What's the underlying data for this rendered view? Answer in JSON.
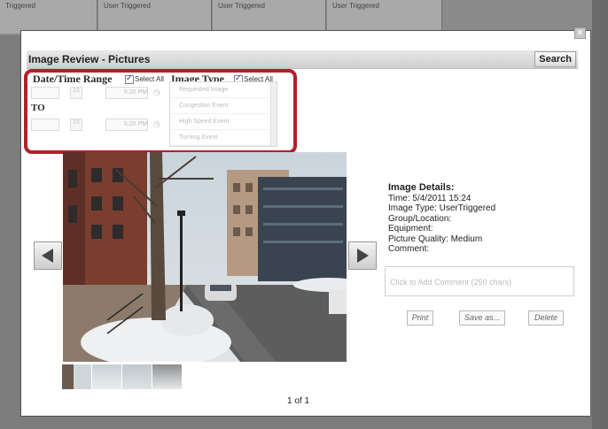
{
  "background_cells": [
    "Triggered",
    "User Triggered",
    "User Triggered",
    "User Triggered"
  ],
  "dialog": {
    "title": "Image Review - Pictures",
    "search_label": "Search",
    "close_glyph": "×"
  },
  "filters": {
    "date_range_label": "Date/Time Range",
    "select_all_label": "Select All",
    "from_time": "5:20 PM",
    "from_day": "15",
    "to_label": "TO",
    "to_time": "5:20 PM",
    "to_day": "15",
    "image_type_label": "Image Type",
    "image_types": [
      "Requested Image",
      "Congestion Event",
      "High Speed Event",
      "Turning Event"
    ]
  },
  "details": {
    "heading": "Image Details:",
    "time": "Time: 5/4/2011 15:24",
    "image_type": "Image Type: UserTriggered",
    "group": "Group/Location:",
    "equipment": "Equipment:",
    "quality": "Picture Quality: Medium",
    "comment_label": "Comment:",
    "comment_placeholder": "Click to Add Comment (250 chars)"
  },
  "actions": {
    "print": "Print",
    "save": "Save as...",
    "delete": "Delete"
  },
  "pager": "1 of 1",
  "icons": {
    "prev": "left-arrow-icon",
    "next": "right-arrow-icon",
    "close": "close-icon"
  },
  "colors": {
    "highlight": "#b3202a",
    "overlay": "#7c7c7c"
  }
}
